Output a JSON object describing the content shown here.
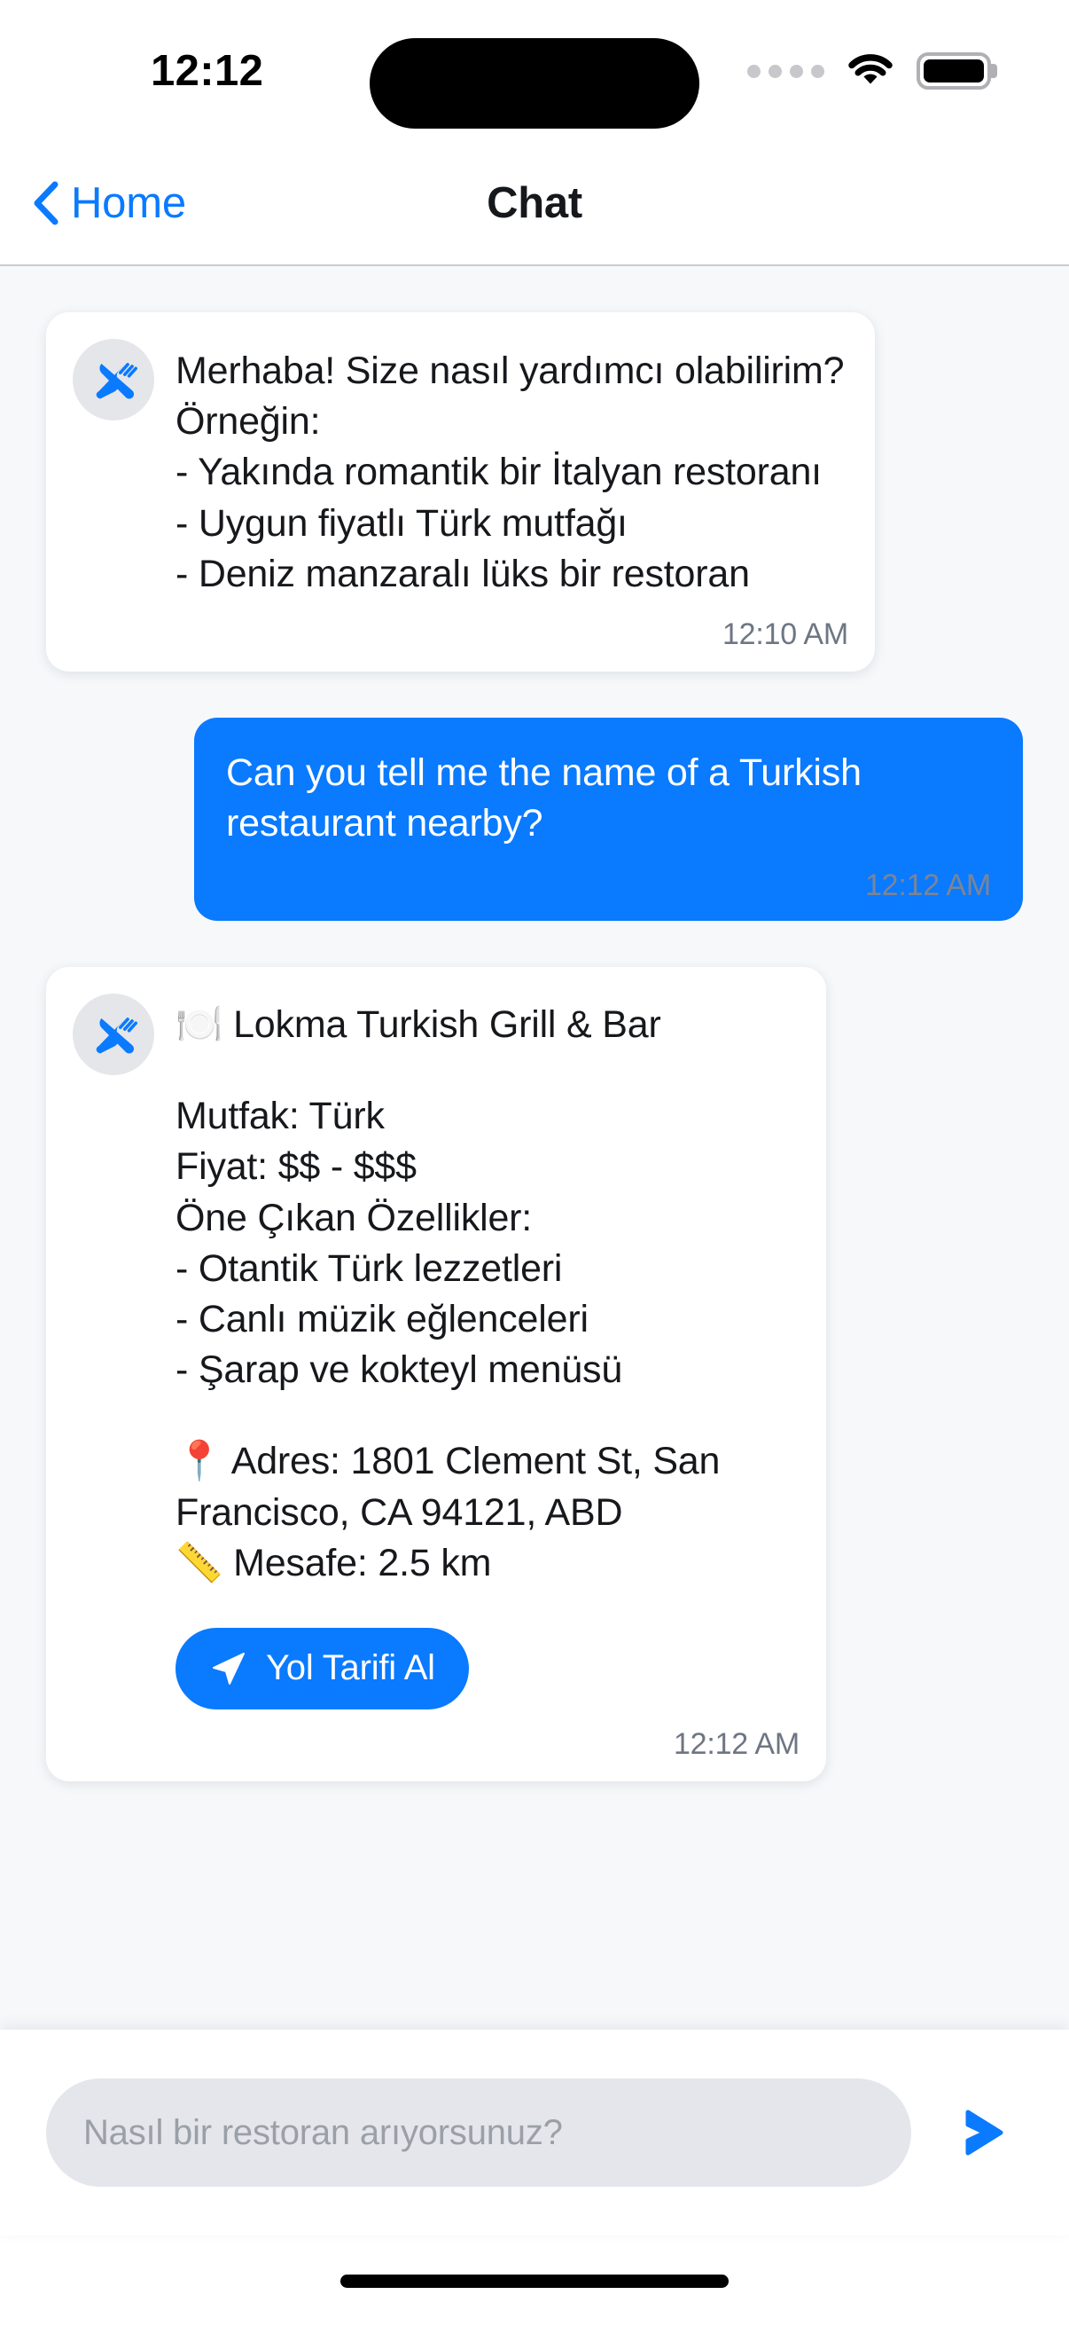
{
  "status_bar": {
    "time": "12:12",
    "signal_icon": "cellular-dots-icon",
    "wifi_icon": "wifi-icon",
    "battery_icon": "battery-full-icon"
  },
  "nav_bar": {
    "back_icon": "chevron-left-icon",
    "back_label": "Home",
    "title": "Chat"
  },
  "messages": [
    {
      "sender": "bot",
      "avatar_icon": "fork-knife-icon",
      "text": "Merhaba! Size nasıl yardımcı olabilirim? Örneğin:\n- Yakında romantik bir İtalyan restoranı\n- Uygun fiyatlı Türk mutfağı\n- Deniz manzaralı lüks bir restoran",
      "time": "12:10 AM"
    },
    {
      "sender": "user",
      "text": "Can you tell me the name of a Turkish restaurant nearby?",
      "time": "12:12 AM"
    }
  ],
  "restaurant_card": {
    "avatar_icon": "fork-knife-icon",
    "title_emoji": "🍽️",
    "title": "Lokma Turkish Grill & Bar",
    "details": "Mutfak: Türk\nFiyat: $$ - $$$\nÖne Çıkan Özellikler:\n- Otantik Türk lezzetleri\n- Canlı müzik eğlenceleri\n- Şarap ve kokteyl menüsü",
    "pin_emoji": "📍",
    "address_label": "Adres:",
    "address": "1801 Clement St, San Francisco, CA 94121, ABD",
    "ruler_emoji": "📏",
    "distance_label": "Mesafe:",
    "distance": "2.5 km",
    "location_block": "📍 Adres: 1801 Clement St, San Francisco, CA 94121, ABD\n📏 Mesafe: 2.5 km",
    "directions_button_label": "Yol Tarifi Al",
    "directions_icon": "navigation-arrow-icon",
    "time": "12:12 AM"
  },
  "input_bar": {
    "placeholder": "Nasıl bir restoran arıyorsunuz?",
    "value": "",
    "send_icon": "send-arrow-icon"
  },
  "colors": {
    "accent_blue": "#0a7aff",
    "page_background": "#f6f8fa",
    "card_white": "#ffffff",
    "text_primary": "#16181c",
    "text_muted": "#6e7683",
    "input_field": "#e4e6eb",
    "avatar_background": "#e5e6e9"
  }
}
